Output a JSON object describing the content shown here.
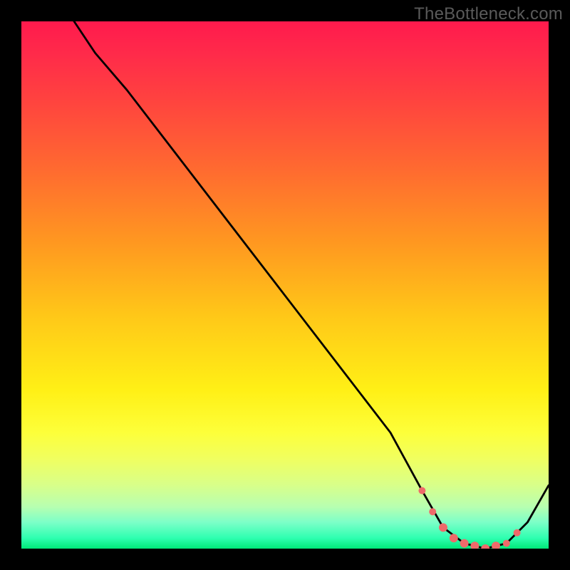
{
  "watermark": "TheBottleneck.com",
  "chart_data": {
    "type": "line",
    "title": "",
    "xlabel": "",
    "ylabel": "",
    "xlim": [
      0,
      100
    ],
    "ylim": [
      0,
      100
    ],
    "background": "rainbow-vertical",
    "series": [
      {
        "name": "bottleneck-curve",
        "x": [
          10,
          14,
          20,
          30,
          40,
          50,
          60,
          70,
          76,
          80,
          84,
          88,
          92,
          96,
          100
        ],
        "y": [
          100,
          94,
          87,
          74,
          61,
          48,
          35,
          22,
          11,
          4,
          1,
          0,
          1,
          5,
          12
        ],
        "stroke": "#000000"
      }
    ],
    "markers": {
      "name": "highlight-dots",
      "color": "#ef6a6a",
      "x": [
        76,
        78,
        80,
        82,
        84,
        86,
        88,
        90,
        92,
        94
      ],
      "y": [
        11,
        7,
        4,
        2,
        1,
        0.5,
        0,
        0.5,
        1,
        3
      ]
    }
  }
}
